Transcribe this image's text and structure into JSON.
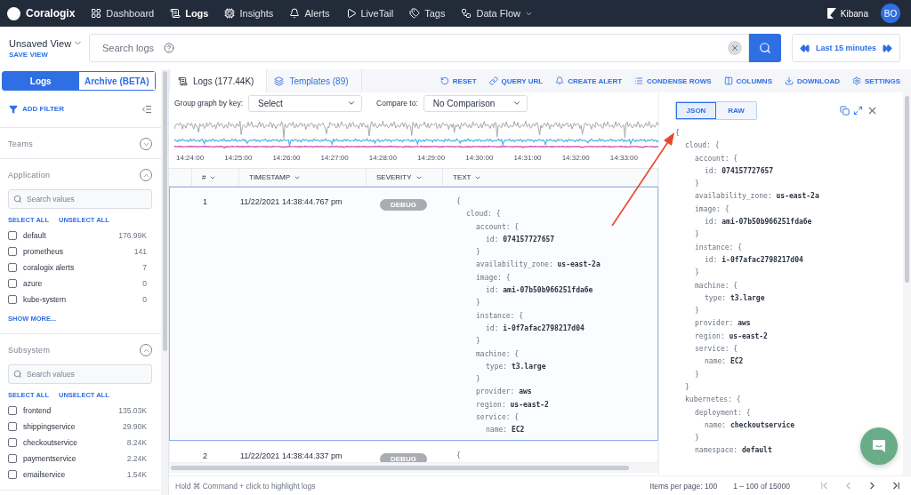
{
  "nav": {
    "logo": "Coralogix",
    "items": [
      {
        "label": "Dashboard",
        "selected": false,
        "menu": false
      },
      {
        "label": "Logs",
        "selected": true,
        "menu": false
      },
      {
        "label": "Insights",
        "selected": false,
        "menu": false
      },
      {
        "label": "Alerts",
        "selected": false,
        "menu": false
      },
      {
        "label": "LiveTail",
        "selected": false,
        "menu": false
      },
      {
        "label": "Tags",
        "selected": false,
        "menu": false
      },
      {
        "label": "Data Flow",
        "selected": false,
        "menu": true
      }
    ],
    "kibana": "Kibana",
    "avatar": "BO"
  },
  "view": {
    "name": "Unsaved View",
    "save": "SAVE VIEW"
  },
  "search": {
    "placeholder": "Search logs"
  },
  "time_range": {
    "label": "Last 15 minutes"
  },
  "sidebar": {
    "tabs": [
      {
        "label": "Logs",
        "selected": true
      },
      {
        "label": "Archive (BETA)",
        "selected": false
      }
    ],
    "add_filter": "ADD FILTER",
    "sections": [
      {
        "title": "Teams",
        "expanded": false
      },
      {
        "title": "Application",
        "expanded": true,
        "placeholder": "Search values",
        "select_all": "SELECT ALL",
        "unselect_all": "UNSELECT ALL",
        "values": [
          {
            "label": "default",
            "count": "176.99K",
            "checked": false
          },
          {
            "label": "prometheus",
            "count": "141",
            "checked": false
          },
          {
            "label": "coralogix alerts",
            "count": "7",
            "checked": false
          },
          {
            "label": "azure",
            "count": "0",
            "checked": false
          },
          {
            "label": "kube-system",
            "count": "0",
            "checked": false
          }
        ],
        "show_more": "SHOW MORE..."
      },
      {
        "title": "Subsystem",
        "expanded": true,
        "placeholder": "Search values",
        "select_all": "SELECT ALL",
        "unselect_all": "UNSELECT ALL",
        "values": [
          {
            "label": "frontend",
            "count": "135.03K",
            "checked": false
          },
          {
            "label": "shippingservice",
            "count": "29.90K",
            "checked": false
          },
          {
            "label": "checkoutservice",
            "count": "8.24K",
            "checked": false
          },
          {
            "label": "paymentservice",
            "count": "2.24K",
            "checked": false
          },
          {
            "label": "emailservice",
            "count": "1.54K",
            "checked": false
          }
        ]
      }
    ]
  },
  "main": {
    "tabs": [
      {
        "label": "Logs (177.44K)",
        "selected": true
      },
      {
        "label": "Templates (89)",
        "selected": false
      }
    ],
    "actions": [
      "RESET",
      "QUERY URL",
      "CREATE ALERT",
      "CONDENSE ROWS",
      "COLUMNS",
      "DOWNLOAD",
      "SETTINGS"
    ]
  },
  "graph": {
    "group_label": "Group graph by key:",
    "group_value": "Select",
    "compare_label": "Compare to:",
    "compare_value": "No Comparison",
    "time_labels": [
      "14:24:00",
      "14:25:00",
      "14:26:00",
      "14:27:00",
      "14:28:00",
      "14:29:00",
      "14:30:00",
      "14:31:00",
      "14:32:00",
      "14:33:00"
    ]
  },
  "table": {
    "columns": [
      "#",
      "TIMESTAMP",
      "SEVERITY",
      "TEXT"
    ],
    "rows": [
      {
        "index": "1",
        "timestamp": "11/22/2021 14:38:44.767 pm",
        "severity": "DEBUG",
        "selected": true,
        "text": [
          {
            "kind": "open",
            "text": "{",
            "children": [
              {
                "kind": "open",
                "key": "cloud:",
                "text": "{",
                "children": [
                  {
                    "kind": "open",
                    "key": "account:",
                    "text": "{",
                    "children": [
                      {
                        "kind": "pair",
                        "key": "id:",
                        "value": "074157727657"
                      }
                    ]
                  },
                  {
                    "kind": "close",
                    "text": "}"
                  },
                  {
                    "kind": "pair",
                    "key": "availability_zone:",
                    "value": "us-east-2a"
                  },
                  {
                    "kind": "open",
                    "key": "image:",
                    "text": "{",
                    "children": [
                      {
                        "kind": "pair",
                        "key": "id:",
                        "value": "ami-07b50b966251fda6e"
                      }
                    ]
                  },
                  {
                    "kind": "close",
                    "text": "}"
                  },
                  {
                    "kind": "open",
                    "key": "instance:",
                    "text": "{",
                    "children": [
                      {
                        "kind": "pair",
                        "key": "id:",
                        "value": "i-0f7afac2798217d04"
                      }
                    ]
                  },
                  {
                    "kind": "close",
                    "text": "}"
                  },
                  {
                    "kind": "open",
                    "key": "machine:",
                    "text": "{",
                    "children": [
                      {
                        "kind": "pair",
                        "key": "type:",
                        "value": "t3.large"
                      }
                    ]
                  },
                  {
                    "kind": "close",
                    "text": "}"
                  },
                  {
                    "kind": "pair",
                    "key": "provider:",
                    "value": "aws"
                  },
                  {
                    "kind": "pair",
                    "key": "region:",
                    "value": "us-east-2"
                  },
                  {
                    "kind": "open",
                    "key": "service:",
                    "text": "{",
                    "children": [
                      {
                        "kind": "pair",
                        "key": "name:",
                        "value": "EC2"
                      }
                    ]
                  }
                ]
              }
            ]
          }
        ]
      },
      {
        "index": "2",
        "timestamp": "11/22/2021 14:38:44.337 pm",
        "severity": "DEBUG",
        "selected": false,
        "text": [
          {
            "kind": "open",
            "text": "{"
          }
        ]
      }
    ]
  },
  "detail": {
    "tabs": [
      {
        "label": "JSON",
        "selected": true
      },
      {
        "label": "RAW",
        "selected": false
      }
    ],
    "json": [
      {
        "kind": "open",
        "text": "{",
        "children": [
          {
            "kind": "open",
            "key": "cloud:",
            "text": "{",
            "children": [
              {
                "kind": "open",
                "key": "account:",
                "text": "{",
                "children": [
                  {
                    "kind": "pair",
                    "key": "id:",
                    "value": "074157727657"
                  }
                ]
              },
              {
                "kind": "close",
                "text": "}"
              },
              {
                "kind": "pair",
                "key": "availability_zone:",
                "value": "us-east-2a"
              },
              {
                "kind": "open",
                "key": "image:",
                "text": "{",
                "children": [
                  {
                    "kind": "pair",
                    "key": "id:",
                    "value": "ami-07b50b966251fda6e"
                  }
                ]
              },
              {
                "kind": "close",
                "text": "}"
              },
              {
                "kind": "open",
                "key": "instance:",
                "text": "{",
                "children": [
                  {
                    "kind": "pair",
                    "key": "id:",
                    "value": "i-0f7afac2798217d04"
                  }
                ]
              },
              {
                "kind": "close",
                "text": "}"
              },
              {
                "kind": "open",
                "key": "machine:",
                "text": "{",
                "children": [
                  {
                    "kind": "pair",
                    "key": "type:",
                    "value": "t3.large"
                  }
                ]
              },
              {
                "kind": "close",
                "text": "}"
              },
              {
                "kind": "pair",
                "key": "provider:",
                "value": "aws"
              },
              {
                "kind": "pair",
                "key": "region:",
                "value": "us-east-2"
              },
              {
                "kind": "open",
                "key": "service:",
                "text": "{",
                "children": [
                  {
                    "kind": "pair",
                    "key": "name:",
                    "value": "EC2"
                  }
                ]
              },
              {
                "kind": "close",
                "text": "}"
              }
            ]
          },
          {
            "kind": "close",
            "text": "}"
          },
          {
            "kind": "open",
            "key": "kubernetes:",
            "text": "{",
            "children": [
              {
                "kind": "open",
                "key": "deployment:",
                "text": "{",
                "children": [
                  {
                    "kind": "pair",
                    "key": "name:",
                    "value": "checkoutservice"
                  }
                ]
              },
              {
                "kind": "close",
                "text": "}"
              },
              {
                "kind": "pair",
                "key": "namespace:",
                "value": "default"
              }
            ]
          }
        ]
      }
    ]
  },
  "footer": {
    "hint": "Hold ⌘ Command + click to highlight logs",
    "items_per_page": "Items per page: 100",
    "range": "1 – 100 of 15000",
    "pager": [
      {
        "disabled": true
      },
      {
        "disabled": true
      },
      {
        "disabled": false
      },
      {
        "disabled": false
      }
    ]
  }
}
